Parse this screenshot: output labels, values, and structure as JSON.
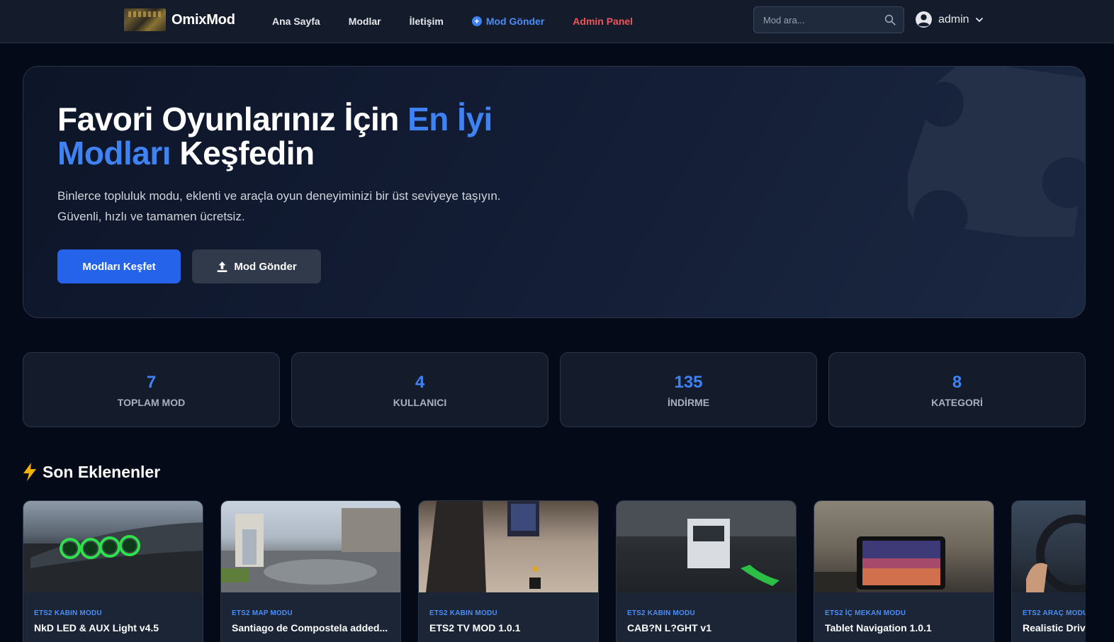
{
  "brand": {
    "name": "OmixMod"
  },
  "nav": {
    "links": [
      "Ana Sayfa",
      "Modlar",
      "İletişim"
    ],
    "submit_mod": "Mod Gönder",
    "admin_panel": "Admin Panel"
  },
  "search": {
    "placeholder": "Mod ara..."
  },
  "user": {
    "name": "admin"
  },
  "hero": {
    "title_part1": "Favori Oyunlarınız İçin ",
    "title_accent": "En İyi Modları",
    "title_part2": " Keşfedin",
    "subtitle_line1": "Binlerce topluluk modu, eklenti ve araçla oyun deneyiminizi bir üst seviyeye taşıyın.",
    "subtitle_line2": "Güvenli, hızlı ve tamamen ücretsiz.",
    "explore_button": "Modları Keşfet",
    "submit_button": "Mod Gönder"
  },
  "stats": [
    {
      "value": "7",
      "label": "TOPLAM MOD"
    },
    {
      "value": "4",
      "label": "KULLANICI"
    },
    {
      "value": "135",
      "label": "İNDİRME"
    },
    {
      "value": "8",
      "label": "KATEGORİ"
    }
  ],
  "recent": {
    "title": "Son Eklenenler",
    "cards": [
      {
        "category": "ETS2 KABIN MODU",
        "title": "NkD LED & AUX Light v4.5"
      },
      {
        "category": "ETS2 MAP MODU",
        "title": "Santiago de Compostela added..."
      },
      {
        "category": "ETS2 KABIN MODU",
        "title": "ETS2 TV MOD 1.0.1"
      },
      {
        "category": "ETS2 KABIN MODU",
        "title": "CAB?N L?GHT v1"
      },
      {
        "category": "ETS2 İÇ MEKAN MODU",
        "title": "Tablet Navigation 1.0.1"
      },
      {
        "category": "ETS2 ARAÇ MODU",
        "title": "Realistic Driving"
      }
    ]
  },
  "colors": {
    "accent": "#3f82f4",
    "primary_button": "#2563eb",
    "admin_link": "#f0555a",
    "background": "#050a18"
  }
}
